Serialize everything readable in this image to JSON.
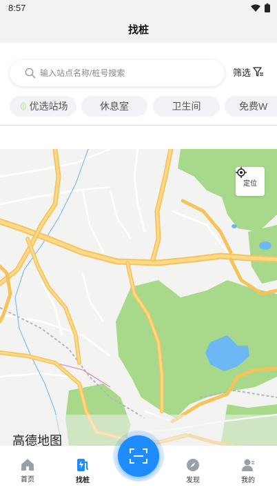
{
  "status_bar": {
    "time": "8:57"
  },
  "header": {
    "title": "找桩"
  },
  "search": {
    "placeholder": "输入站点名称/桩号搜索",
    "value": ""
  },
  "filter": {
    "label": "筛选"
  },
  "chips": [
    {
      "label": "优选站场",
      "icon": "leaf-icon"
    },
    {
      "label": "休息室"
    },
    {
      "label": "卫生间"
    },
    {
      "label": "免费W"
    }
  ],
  "map": {
    "locate_label": "定位",
    "logo": "高德地图"
  },
  "tabbar": {
    "items": [
      {
        "label": "首页",
        "icon": "home-icon"
      },
      {
        "label": "找桩",
        "icon": "charging-pile-icon",
        "active": true
      },
      {
        "label": "发现",
        "icon": "compass-icon"
      },
      {
        "label": "我的",
        "icon": "user-icon"
      }
    ],
    "center_icon": "scan-icon"
  },
  "colors": {
    "accent": "#1e8cff",
    "park": "#a8d98a",
    "water": "#6db7f5",
    "road": "#f6c35b"
  }
}
